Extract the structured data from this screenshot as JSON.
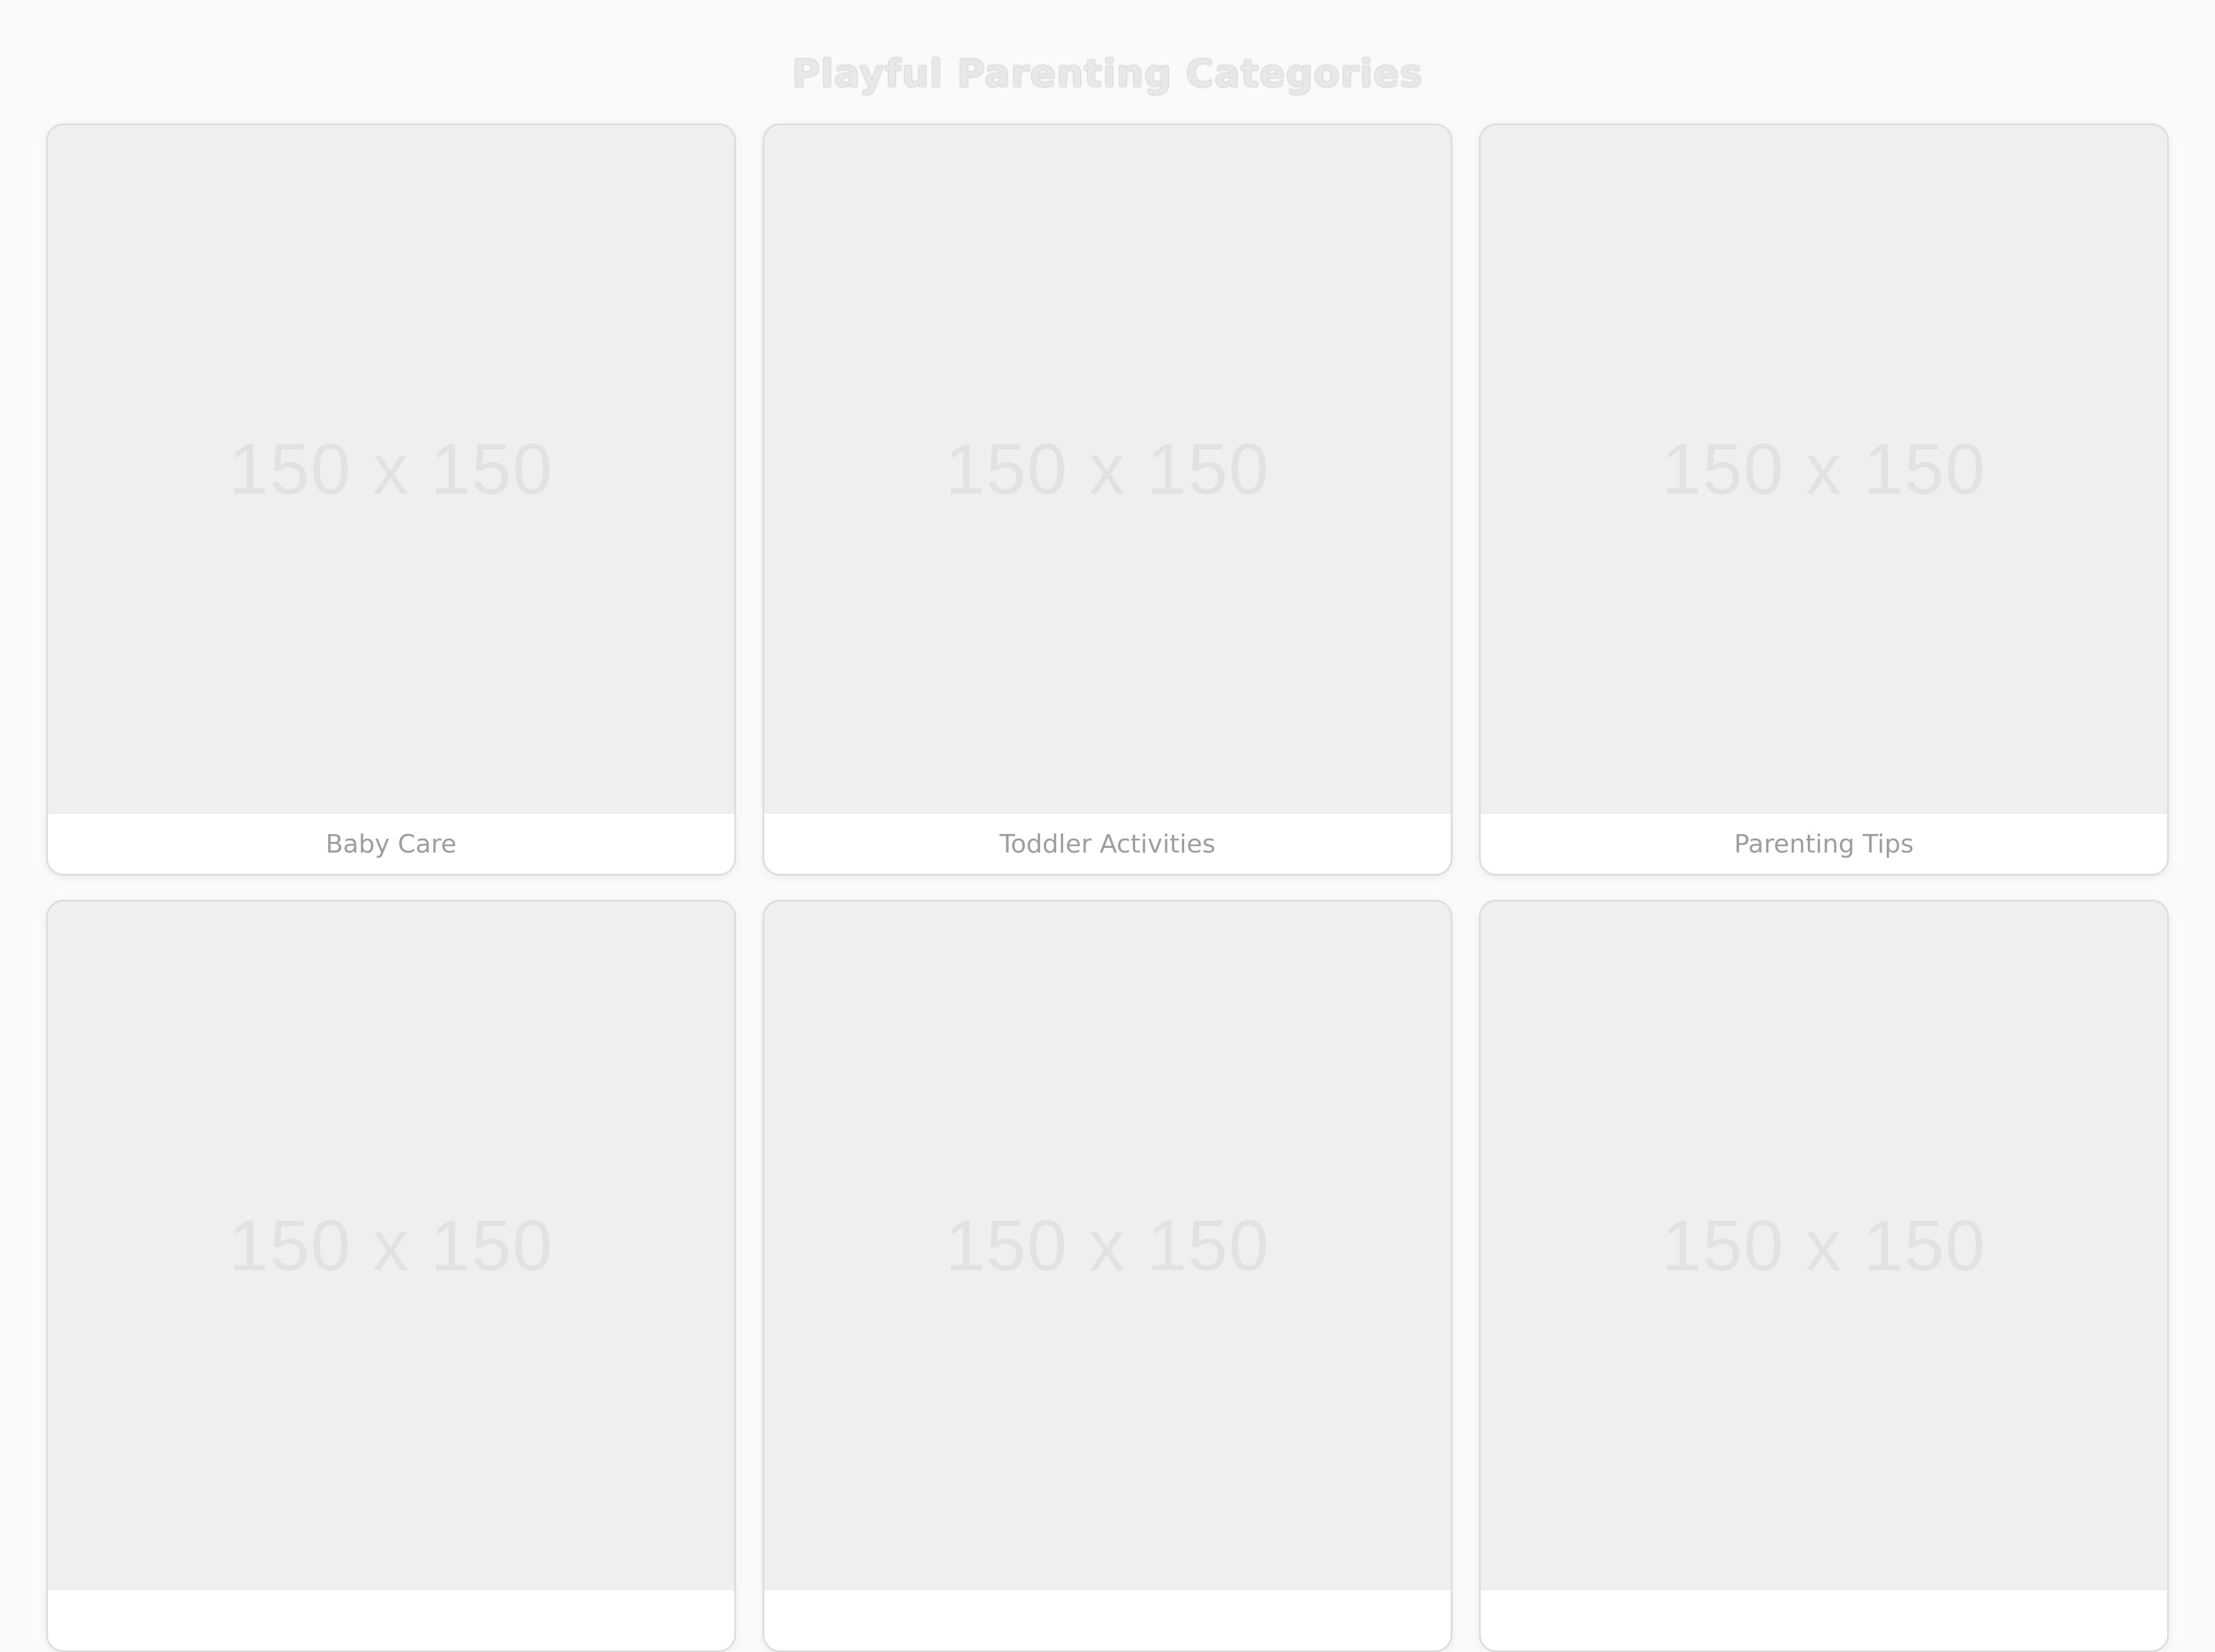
{
  "header": {
    "title": "Playful Parenting Categories"
  },
  "categories": [
    {
      "placeholder": "150 x 150",
      "label": "Baby Care"
    },
    {
      "placeholder": "150 x 150",
      "label": "Toddler Activities"
    },
    {
      "placeholder": "150 x 150",
      "label": "Parenting Tips"
    },
    {
      "placeholder": "150 x 150",
      "label": ""
    },
    {
      "placeholder": "150 x 150",
      "label": ""
    },
    {
      "placeholder": "150 x 150",
      "label": ""
    }
  ],
  "colors": {
    "background": "#fafafa",
    "card_border": "#dcdcdc",
    "image_placeholder": "#efefef",
    "label_text": "#9e9e9e"
  }
}
